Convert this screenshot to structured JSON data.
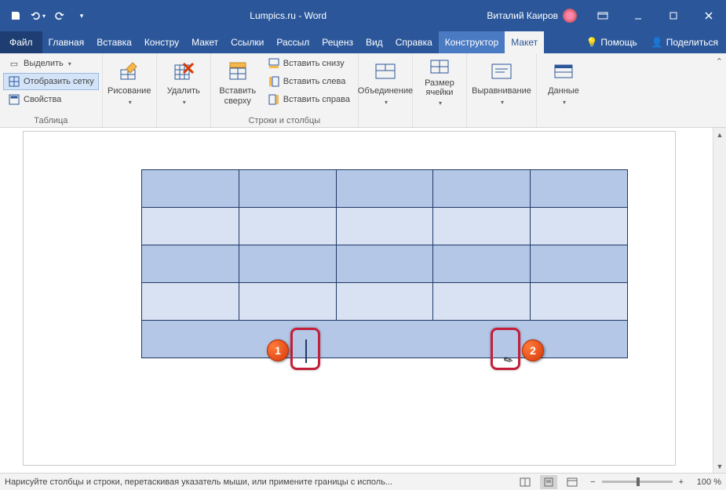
{
  "title": "Lumpics.ru - Word",
  "user": "Виталий Каиров",
  "tabs": {
    "file": "Файл",
    "items": [
      "Главная",
      "Вставка",
      "Констру",
      "Макет",
      "Ссылки",
      "Рассыл",
      "Реценз",
      "Вид",
      "Справка",
      "Конструктор",
      "Макет"
    ],
    "active_index": 10,
    "ctx_start": 9,
    "tell": "Помощь",
    "share": "Поделиться"
  },
  "ribbon": {
    "table": {
      "label": "Таблица",
      "select": "Выделить",
      "gridlines": "Отобразить сетку",
      "properties": "Свойства"
    },
    "draw": {
      "label": "Рисование"
    },
    "delete": {
      "label": "Удалить"
    },
    "rowscols": {
      "label": "Строки и столбцы",
      "insert_above": "Вставить\nсверху",
      "insert_below": "Вставить снизу",
      "insert_left": "Вставить слева",
      "insert_right": "Вставить справа"
    },
    "merge": {
      "label": "Объединение"
    },
    "cellsize": {
      "label": "Размер\nячейки"
    },
    "align": {
      "label": "Выравнивание"
    },
    "data": {
      "label": "Данные"
    }
  },
  "doc_table": {
    "rows": 5,
    "cols": 5
  },
  "marks": {
    "badge1": "1",
    "badge2": "2"
  },
  "status": {
    "msg": "Нарисуйте столбцы и строки, перетаскивая указатель мыши, или примените границы с исполь...",
    "zoom": "100 %"
  }
}
